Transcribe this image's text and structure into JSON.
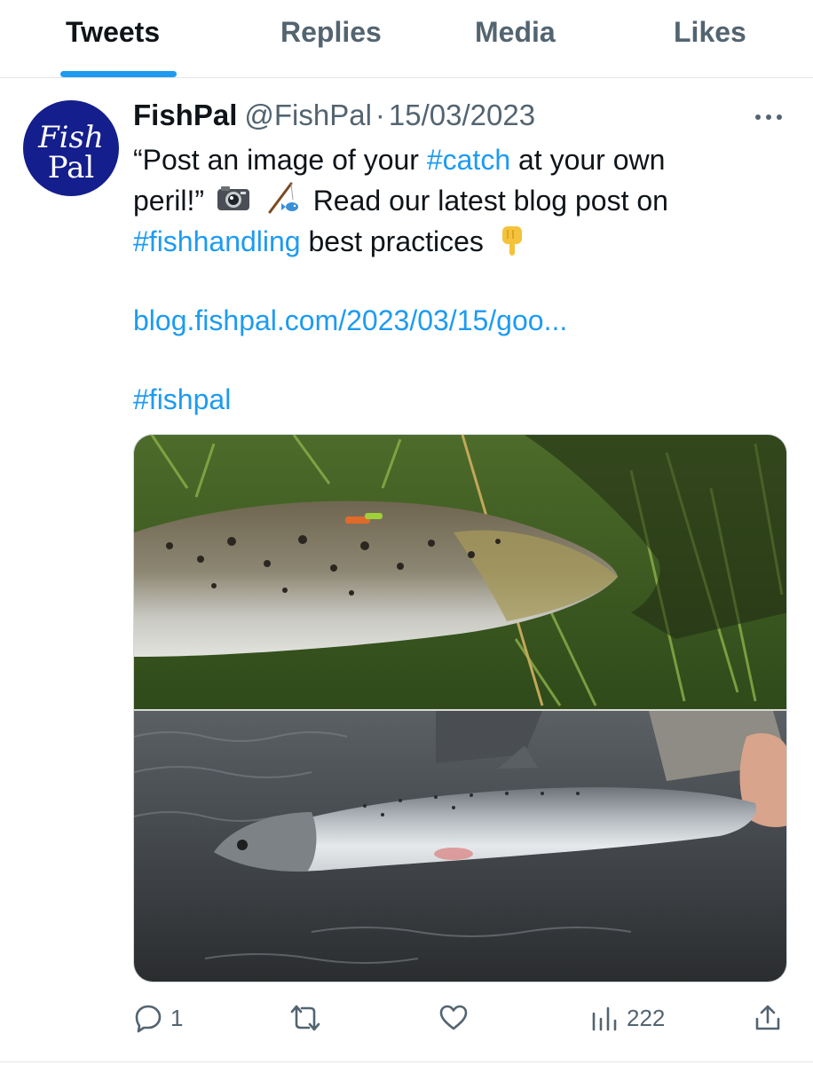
{
  "tabs": [
    {
      "label": "Tweets",
      "active": true
    },
    {
      "label": "Replies",
      "active": false
    },
    {
      "label": "Media",
      "active": false
    },
    {
      "label": "Likes",
      "active": false
    }
  ],
  "tweet": {
    "avatar": {
      "line1": "Fish",
      "line2": "Pal",
      "bg": "#141e8c"
    },
    "display_name": "FishPal",
    "handle": "@FishPal",
    "separator": "·",
    "date": "15/03/2023",
    "text": {
      "l1_a": "“Post an image of your ",
      "l1_tag": "#catch",
      "l1_b": " at your own",
      "l2_a": "peril!”",
      "l2_b": " Read our latest blog post on",
      "l3_tag": "#fishhandling",
      "l3_b": " best practices",
      "link": "blog.fishpal.com/2023/03/15/goo...",
      "l5_tag": "#fishpal"
    },
    "emojis": [
      "camera-emoji",
      "fishing-pole-emoji",
      "pointing-down-emoji"
    ],
    "media": {
      "alt_top": "brown trout lying on grass",
      "alt_bottom": "salmon held in water"
    },
    "actions": {
      "reply_count": "1",
      "retweet_count": "",
      "like_count": "",
      "views_count": "222"
    }
  },
  "colors": {
    "accent": "#1d9bf0",
    "text": "#0f1419",
    "secondary": "#536471",
    "avatar_bg": "#141e8c"
  }
}
